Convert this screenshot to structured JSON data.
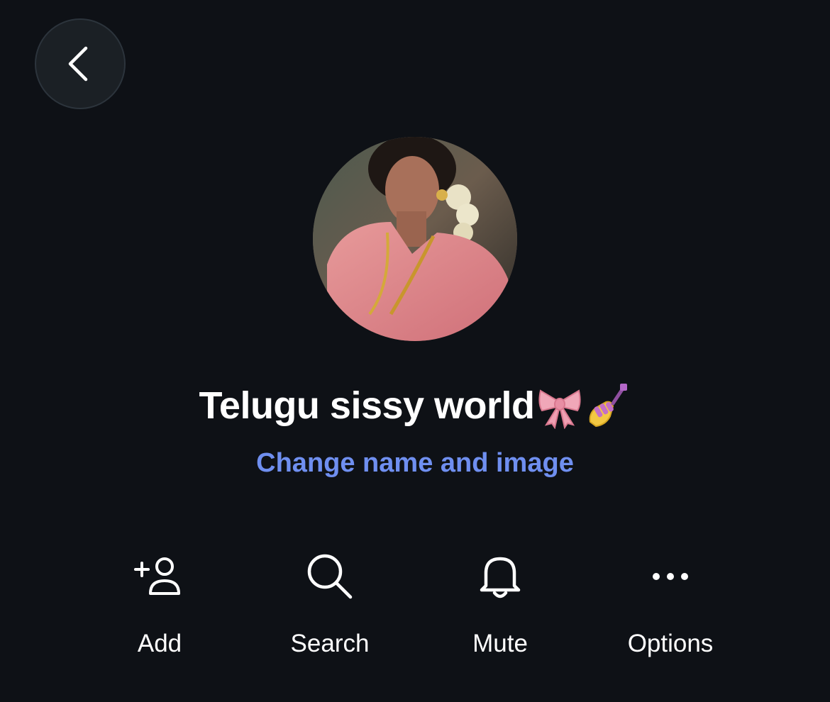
{
  "navigation": {
    "back_icon": "chevron-left-icon"
  },
  "group": {
    "avatar_icon": "group-avatar-photo",
    "name": "Telugu sissy world",
    "name_emojis": [
      "ribbon-emoji",
      "nail-polish-emoji"
    ],
    "change_link": "Change name and image"
  },
  "actions": [
    {
      "icon": "add-person-icon",
      "label": "Add"
    },
    {
      "icon": "search-icon",
      "label": "Search"
    },
    {
      "icon": "bell-icon",
      "label": "Mute"
    },
    {
      "icon": "more-horizontal-icon",
      "label": "Options"
    }
  ],
  "colors": {
    "background": "#0e1116",
    "link": "#6f8ff0",
    "text": "#ffffff",
    "back_button_bg": "#1b2025"
  }
}
